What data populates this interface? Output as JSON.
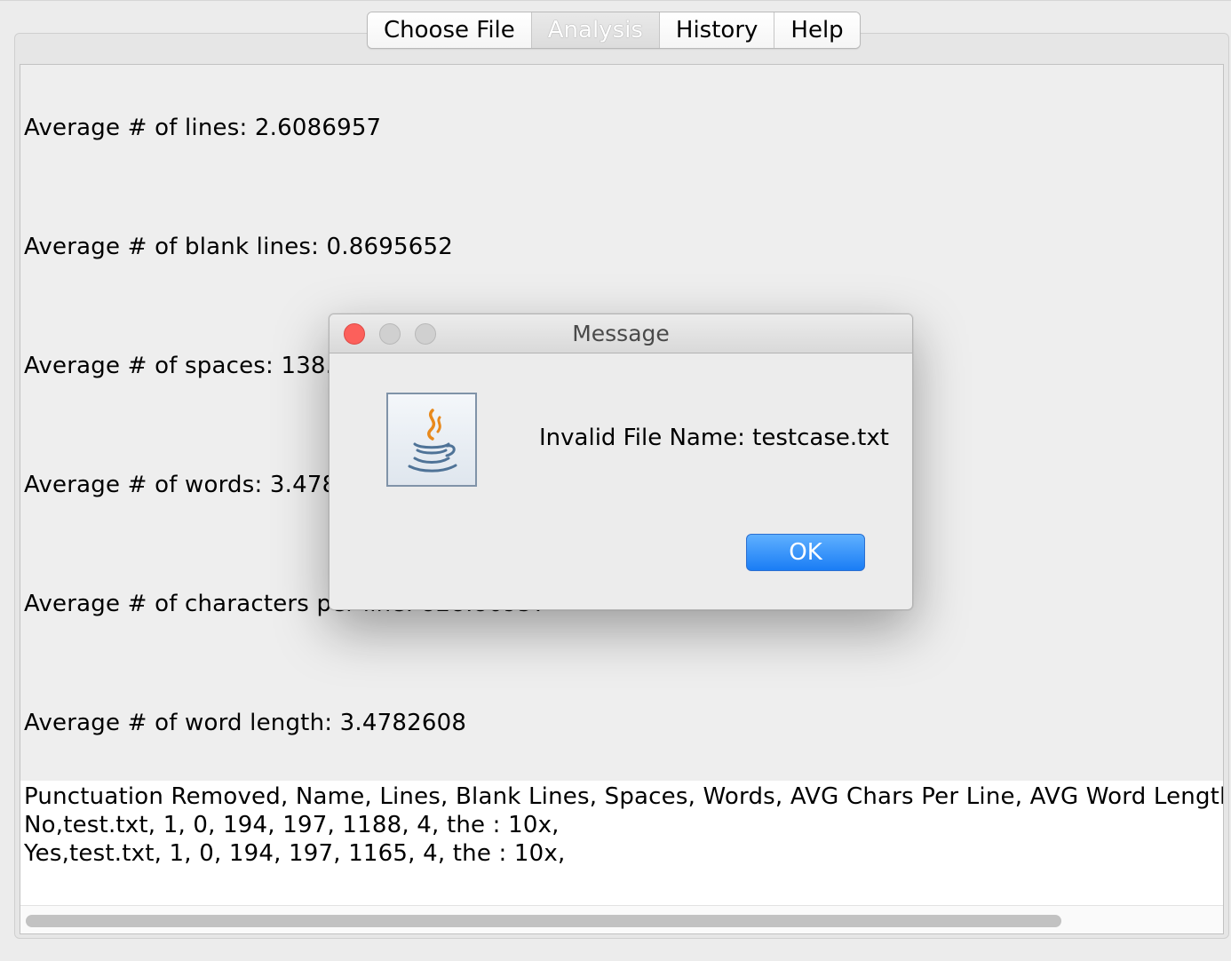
{
  "tabs": [
    "Choose File",
    "Analysis",
    "History",
    "Help"
  ],
  "selected_tab": "Analysis",
  "stats": [
    "Average # of lines: 2.6086957",
    "Average # of blank lines: 0.8695652",
    "Average # of spaces: 138.95",
    "Average # of words: 3.4782",
    "Average # of characters per line: 828.86957",
    "Average # of word length: 3.4782608"
  ],
  "csv": {
    "header": "Punctuation Removed, Name, Lines, Blank Lines, Spaces, Words, AVG Chars Per Line, AVG Word Length, Most Common Words",
    "rows": [
      "No,test.txt, 1, 0, 194, 197, 1188, 4, the : 10x,",
      "Yes,test.txt, 1, 0, 194, 197, 1165, 4, the : 10x,"
    ]
  },
  "horizontal_scroll_fraction": 0.86,
  "dialog": {
    "title": "Message",
    "message": "Invalid File Name: testcase.txt",
    "ok_label": "OK",
    "icon": "java-coffee-cup-icon"
  },
  "colors": {
    "close_button": "#fc605b",
    "ok_button": "#1a7df5"
  }
}
